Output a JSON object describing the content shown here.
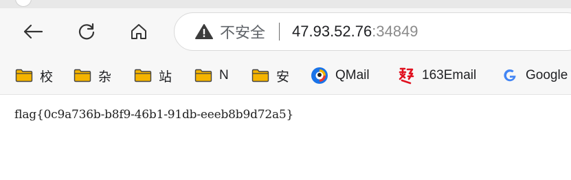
{
  "toolbar": {
    "back_icon": "arrow-left-icon",
    "reload_icon": "reload-icon",
    "home_icon": "home-icon"
  },
  "address_bar": {
    "security_icon": "warning-triangle-icon",
    "security_label": "不安全",
    "host": "47.93.52.76",
    "port": ":34849"
  },
  "bookmarks": [
    {
      "label": "校",
      "icon": "folder-icon"
    },
    {
      "label": "杂",
      "icon": "folder-icon"
    },
    {
      "label": "站",
      "icon": "folder-icon"
    },
    {
      "label": "N",
      "icon": "folder-icon"
    },
    {
      "label": "安",
      "icon": "folder-icon"
    },
    {
      "label": "QMail",
      "icon": "qmail-icon"
    },
    {
      "label": "163Email",
      "icon": "163-icon"
    },
    {
      "label": "Google",
      "icon": "google-icon"
    }
  ],
  "page": {
    "text": "flag{0c9a736b-b8f9-46b1-91db-eeeb8b9d72a5}"
  },
  "colors": {
    "folder": "#f5b400",
    "folder_stroke": "#444444",
    "netease_red": "#e0101f",
    "google_blue": "#4285f4"
  }
}
